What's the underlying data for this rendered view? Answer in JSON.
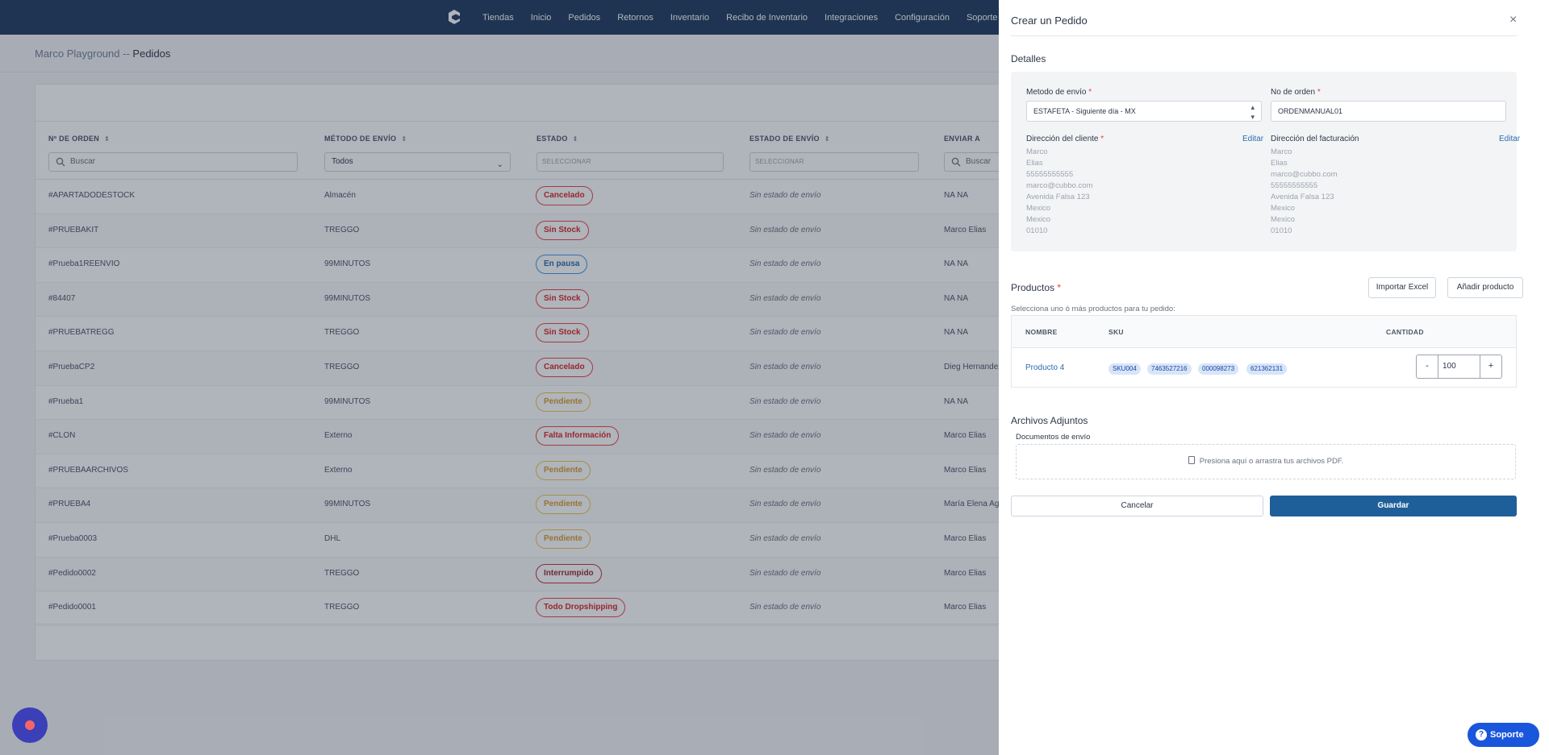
{
  "nav": {
    "links": [
      "Tiendas",
      "Inicio",
      "Pedidos",
      "Retornos",
      "Inventario",
      "Recibo de Inventario",
      "Integraciones",
      "Configuración",
      "Soporte"
    ]
  },
  "breadcrumb": {
    "store": "Marco Playground",
    "sep": "--",
    "page": "Pedidos"
  },
  "table": {
    "columns": [
      "Nº DE ORDEN",
      "MÉTODO DE ENVÍO",
      "ESTADO",
      "ESTADO DE ENVÍO",
      "ENVIAR A"
    ],
    "filters": {
      "order_placeholder": "Buscar",
      "method_value": "Todos",
      "status_placeholder": "SELECCIONAR",
      "shipping_status_placeholder": "SELECCIONAR",
      "send_to_placeholder": "Buscar"
    },
    "rows": [
      {
        "order": "#APARTADODESTOCK",
        "method": "Almacén",
        "status": "Cancelado",
        "status_color": "red",
        "shipping": "Sin estado de envío",
        "send_to": "NA NA"
      },
      {
        "order": "#PRUEBAKIT",
        "method": "TREGGO",
        "status": "Sin Stock",
        "status_color": "red",
        "shipping": "Sin estado de envío",
        "send_to": "Marco Elias"
      },
      {
        "order": "#Prueba1REENVIO",
        "method": "99MINUTOS",
        "status": "En pausa",
        "status_color": "blue",
        "shipping": "Sin estado de envío",
        "send_to": "NA NA"
      },
      {
        "order": "#84407",
        "method": "99MINUTOS",
        "status": "Sin Stock",
        "status_color": "red",
        "shipping": "Sin estado de envío",
        "send_to": "NA NA"
      },
      {
        "order": "#PRUEBATREGG",
        "method": "TREGGO",
        "status": "Sin Stock",
        "status_color": "red",
        "shipping": "Sin estado de envío",
        "send_to": "NA NA"
      },
      {
        "order": "#PruebaCP2",
        "method": "TREGGO",
        "status": "Cancelado",
        "status_color": "red",
        "shipping": "Sin estado de envío",
        "send_to": "Dieg Hernandez"
      },
      {
        "order": "#Prueba1",
        "method": "99MINUTOS",
        "status": "Pendiente",
        "status_color": "yellow",
        "shipping": "Sin estado de envío",
        "send_to": "NA NA"
      },
      {
        "order": "#CLON",
        "method": "Externo",
        "status": "Falta Información",
        "status_color": "red",
        "shipping": "Sin estado de envío",
        "send_to": "Marco Elias"
      },
      {
        "order": "#PRUEBAARCHIVOS",
        "method": "Externo",
        "status": "Pendiente",
        "status_color": "yellow",
        "shipping": "Sin estado de envío",
        "send_to": "Marco Elias"
      },
      {
        "order": "#PRUEBA4",
        "method": "99MINUTOS",
        "status": "Pendiente",
        "status_color": "yellow",
        "shipping": "Sin estado de envío",
        "send_to": "María Elena Agu"
      },
      {
        "order": "#Prueba0003",
        "method": "DHL",
        "status": "Pendiente",
        "status_color": "yellow",
        "shipping": "Sin estado de envío",
        "send_to": "Marco Elias"
      },
      {
        "order": "#Pedido0002",
        "method": "TREGGO",
        "status": "Interrumpido",
        "status_color": "brown",
        "shipping": "Sin estado de envío",
        "send_to": "Marco Elias"
      },
      {
        "order": "#Pedido0001",
        "method": "TREGGO",
        "status": "Todo Dropshipping",
        "status_color": "red",
        "shipping": "Sin estado de envío",
        "send_to": "Marco Elias"
      }
    ]
  },
  "drawer": {
    "title": "Crear un Pedido",
    "details_title": "Detalles",
    "shipping_method_label": "Metodo de envío",
    "shipping_method_value": "ESTAFETA - Siguiente día - MX",
    "order_no_label": "No de orden",
    "order_no_value": "ORDENMANUAL01",
    "customer_address_label": "Dirección del cliente",
    "billing_address_label": "Dirección del facturación",
    "edit_label": "Editar",
    "customer_address": [
      "Marco",
      "Elias",
      "55555555555",
      "marco@cubbo.com",
      "Avenida Falsa 123",
      "Mexico",
      "Mexico",
      "01010"
    ],
    "billing_address": [
      "Marco",
      "Elias",
      "marco@cubbo.com",
      "55555555555",
      "Avenida Falsa 123",
      "Mexico",
      "Mexico",
      "01010"
    ],
    "products_title": "Productos",
    "products_hint": "Selecciona uno ó más productos para tu pedido:",
    "import_excel": "Importar Excel",
    "add_product": "Añadir producto",
    "product_columns": [
      "NOMBRE",
      "SKU",
      "CANTIDAD"
    ],
    "product": {
      "name": "Producto 4",
      "skus": [
        "SKU004",
        "7463527216",
        "000098273",
        "621362131"
      ],
      "quantity": "100",
      "minus": "-",
      "plus": "+"
    },
    "attachments_title": "Archivos Adjuntos",
    "shipping_docs_label": "Documentos de envío",
    "dropzone_text": "Presiona aquí o arrastra tus archivos PDF.",
    "cancel": "Cancelar",
    "save": "Guardar",
    "required_mark": "*"
  },
  "support_button": "Soporte",
  "icons": {
    "close": "×",
    "help": "?"
  },
  "colors": {
    "nav_bg": "#1f3b5e",
    "primary": "#1f5f99",
    "support": "#1a56db"
  }
}
